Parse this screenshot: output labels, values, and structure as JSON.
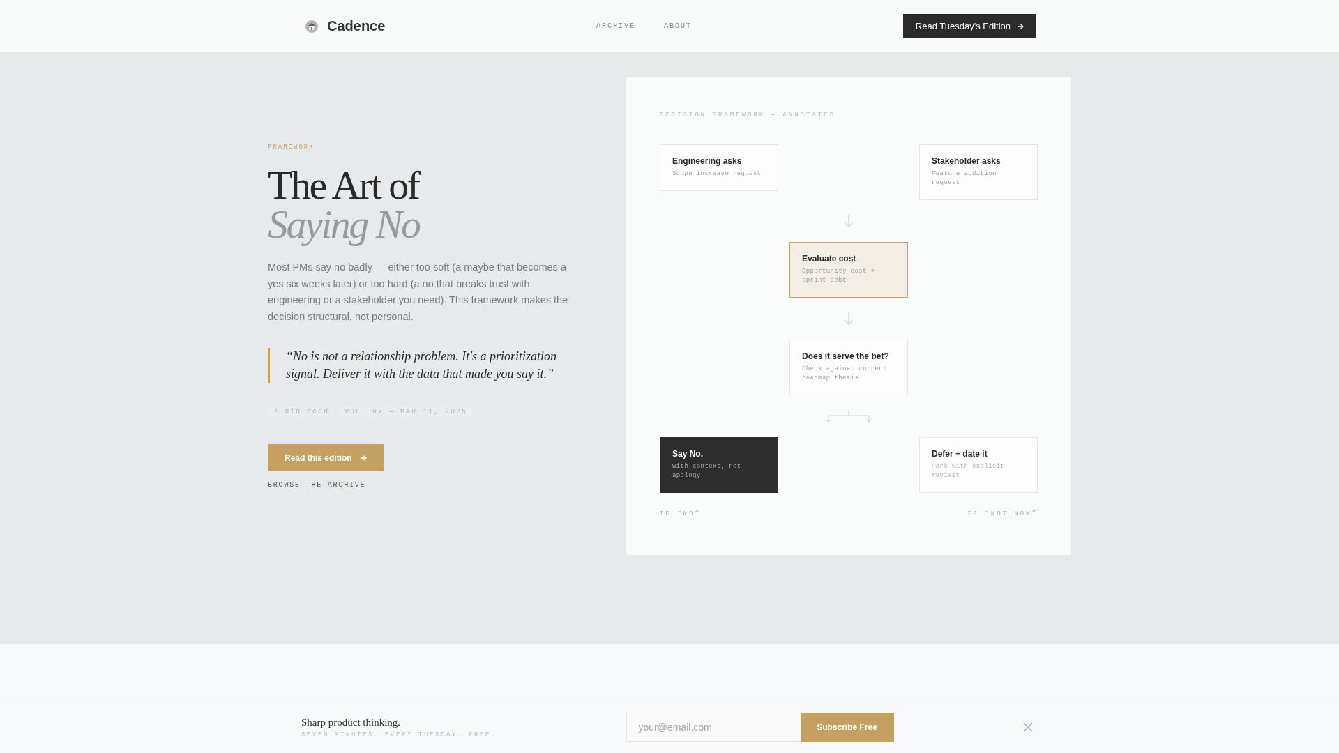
{
  "header": {
    "brand": "Cadence",
    "nav": [
      {
        "label": "ARCHIVE"
      },
      {
        "label": "ABOUT"
      }
    ],
    "cta": "Read Tuesday's Edition"
  },
  "hero": {
    "eyebrow": "FRAMEWORK",
    "title": [
      {
        "text": "The Art of",
        "italic": false
      },
      {
        "text": "Saying No",
        "italic": true
      }
    ],
    "intro": "Most PMs say no badly — either too soft (a maybe that becomes a yes six weeks later) or too hard (a no that breaks trust with engineering or a stakeholder you need). This framework makes the decision structural, not personal.",
    "quote": "“No is not a relationship problem. It's a prioritization signal. Deliver it with the data that made you say it.”",
    "meta": [
      "7 min read",
      "VOL. 97 — MAR 11, 2025"
    ],
    "primary_button": "Read this edition",
    "secondary_link": "BROWSE THE ARCHIVE"
  },
  "diagram": {
    "label": "DECISION FRAMEWORK — ANNOTATED",
    "rows": [
      {
        "kind": "pair",
        "nodes": [
          {
            "title": "Engineering asks",
            "note": "Scope increase request",
            "kind": "plain"
          },
          {
            "title": "Stakeholder asks",
            "note": "Feature addition request",
            "kind": "plain"
          }
        ]
      },
      {
        "kind": "single",
        "nodes": [
          {
            "title": "Evaluate cost",
            "note": "Opportunity cost + sprint debt",
            "kind": "accent"
          }
        ]
      },
      {
        "kind": "single",
        "nodes": [
          {
            "title": "Does it serve the bet?",
            "note": "Check against current roadmap thesis",
            "kind": "plain"
          }
        ]
      },
      {
        "kind": "pair",
        "nodes": [
          {
            "title": "Say No.",
            "note": "With context, not apology",
            "kind": "dark"
          },
          {
            "title": "Defer + date it",
            "note": "Park with explicit revisit",
            "kind": "faded"
          }
        ]
      }
    ],
    "outcome_labels": [
      "IF “NO”",
      "IF “NOT NOW”"
    ]
  },
  "subscribe_bar": {
    "headline": "Sharp product thinking.",
    "tagline": "SEVEN MINUTES. EVERY TUESDAY. FREE.",
    "email": {
      "placeholder": "your@email.com"
    },
    "button": "Subscribe Free"
  }
}
